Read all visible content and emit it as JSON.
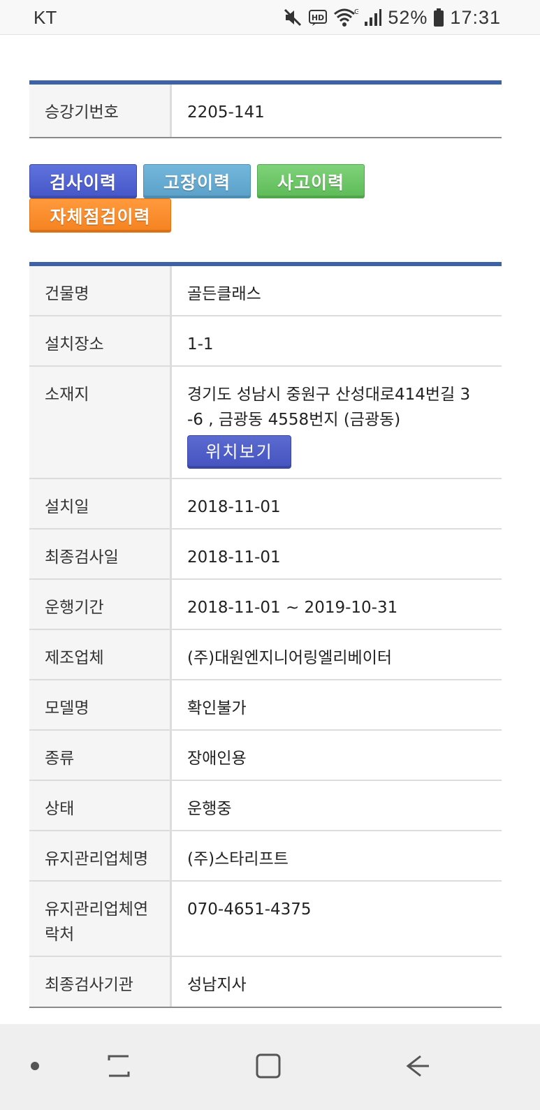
{
  "status_bar": {
    "carrier": "KT",
    "battery_percent": "52%",
    "time": "17:31",
    "icons": [
      "mute-icon",
      "hd-icon",
      "wifi-icon",
      "signal-icon",
      "battery-icon"
    ]
  },
  "elevator_info": {
    "label": "승강기번호",
    "value": "2205-141"
  },
  "tabs": {
    "inspection": "검사이력",
    "failure": "고장이력",
    "accident": "사고이력",
    "self_check": "자체점검이력"
  },
  "details": {
    "building_name": {
      "label": "건물명",
      "value": "골든클래스"
    },
    "install_location": {
      "label": "설치장소",
      "value": "1-1"
    },
    "address": {
      "label": "소재지",
      "line1": "경기도 성남시 중원구 산성대로414번길 3",
      "line2": "-6 , 금광동 4558번지 (금광동)",
      "map_button": "위치보기"
    },
    "install_date": {
      "label": "설치일",
      "value": "2018-11-01"
    },
    "last_inspection_date": {
      "label": "최종검사일",
      "value": "2018-11-01"
    },
    "operation_period": {
      "label": "운행기간",
      "value": "2018-11-01 ~ 2019-10-31"
    },
    "manufacturer": {
      "label": "제조업체",
      "value": "(주)대원엔지니어링엘리베이터"
    },
    "model_name": {
      "label": "모델명",
      "value": "확인불가"
    },
    "type": {
      "label": "종류",
      "value": "장애인용"
    },
    "status": {
      "label": "상태",
      "value": "운행중"
    },
    "maintenance_company": {
      "label": "유지관리업체명",
      "value": "(주)스타리프트"
    },
    "maintenance_contact": {
      "label_line1": "유지관리업체연",
      "label_line2": "락처",
      "value": "070-4651-4375"
    },
    "last_inspection_agency": {
      "label": "최종검사기관",
      "value": "성남지사"
    }
  },
  "colors": {
    "table_top_border": "#3d62a8",
    "tab_inspection": "#4f61d0",
    "tab_failure": "#66abd2",
    "tab_accident": "#6cc566",
    "tab_self_check": "#f98a2a",
    "location_button": "#4f5ec7"
  }
}
